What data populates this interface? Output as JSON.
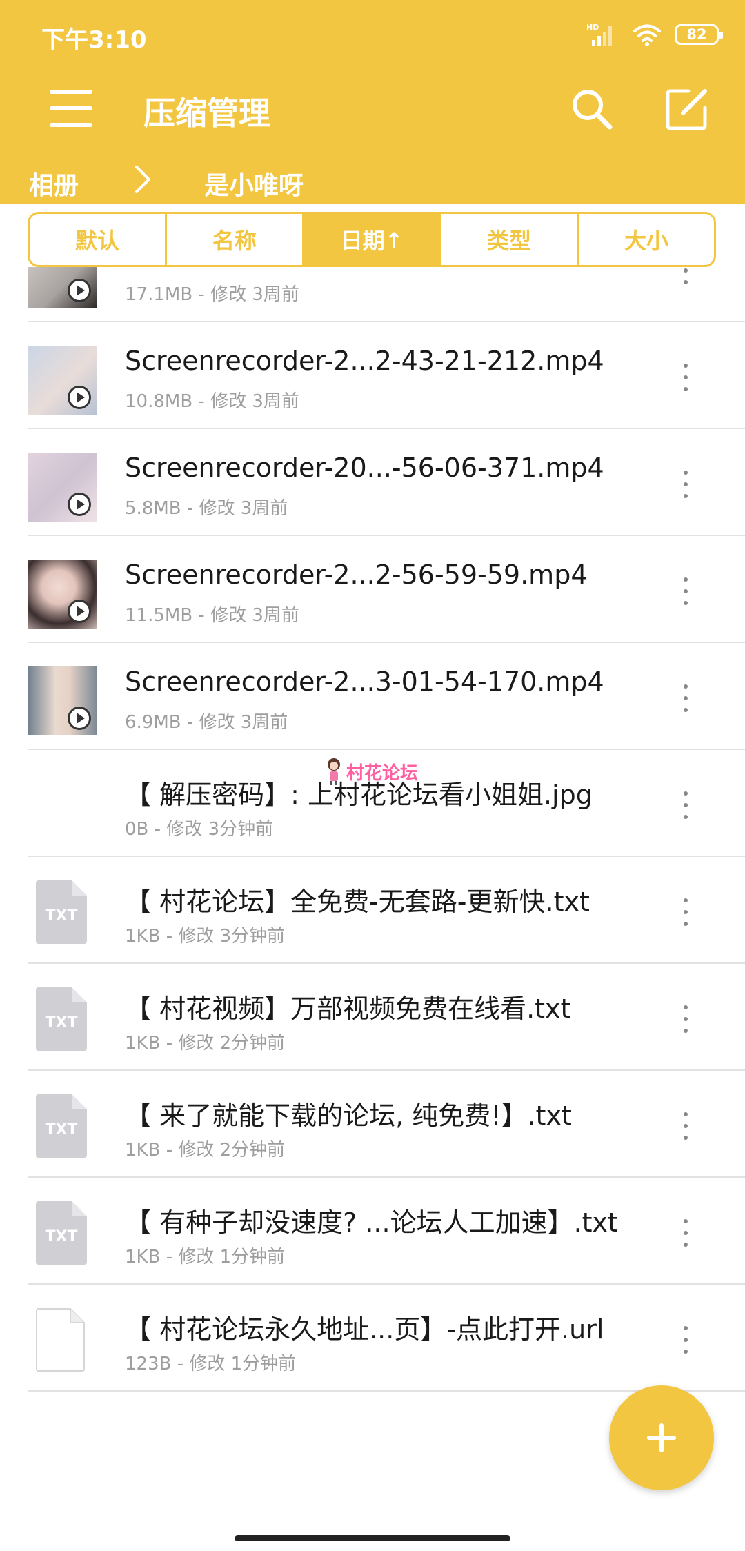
{
  "status_bar": {
    "time": "下午3:10",
    "network": "HD",
    "battery": "82"
  },
  "app_bar": {
    "title": "压缩管理",
    "menu_icon": "menu-icon",
    "search_icon": "search-icon",
    "edit_icon": "edit-icon"
  },
  "breadcrumb": {
    "root": "相册",
    "current": "是小唯呀"
  },
  "sort_tabs": [
    {
      "label": "默认",
      "active": false
    },
    {
      "label": "名称",
      "active": false
    },
    {
      "label": "日期↑",
      "active": true
    },
    {
      "label": "类型",
      "active": false
    },
    {
      "label": "大小",
      "active": false
    }
  ],
  "files": [
    {
      "name": "",
      "meta": "17.1MB - 修改 3周前",
      "kind": "video"
    },
    {
      "name": "Screenrecorder-2...2-43-21-212.mp4",
      "meta": "10.8MB - 修改 3周前",
      "kind": "video"
    },
    {
      "name": "Screenrecorder-20...-56-06-371.mp4",
      "meta": "5.8MB - 修改 3周前",
      "kind": "video"
    },
    {
      "name": "Screenrecorder-2...2-56-59-59.mp4",
      "meta": "11.5MB - 修改 3周前",
      "kind": "video"
    },
    {
      "name": "Screenrecorder-2...3-01-54-170.mp4",
      "meta": "6.9MB - 修改 3周前",
      "kind": "video"
    },
    {
      "name": "【 解压密码】: 上村花论坛看小姐姐.jpg",
      "meta": "0B - 修改 3分钟前",
      "kind": "image"
    },
    {
      "name": "【 村花论坛】全免费-无套路-更新快.txt",
      "meta": "1KB - 修改 3分钟前",
      "kind": "txt"
    },
    {
      "name": "【 村花视频】万部视频免费在线看.txt",
      "meta": "1KB - 修改 2分钟前",
      "kind": "txt"
    },
    {
      "name": "【 来了就能下载的论坛, 纯免费!】.txt",
      "meta": "1KB - 修改 2分钟前",
      "kind": "txt"
    },
    {
      "name": "【 有种子却没速度? ...论坛人工加速】.txt",
      "meta": "1KB - 修改 1分钟前",
      "kind": "txt"
    },
    {
      "name": "【 村花论坛永久地址...页】-点此打开.url",
      "meta": "123B - 修改 1分钟前",
      "kind": "file"
    }
  ],
  "file_type_label": "TXT",
  "watermark": "村花论坛",
  "fab_icon": "plus-icon",
  "colors": {
    "accent": "#f3c641",
    "meta_text": "#9e9e9e",
    "divider": "#e2e2e2"
  }
}
